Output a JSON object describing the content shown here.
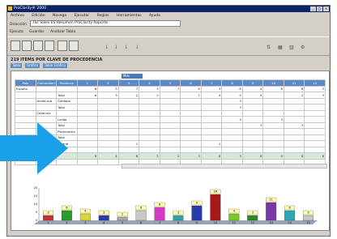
{
  "window": {
    "title": "ProClarity® 2000"
  },
  "menu": [
    "Archivo",
    "Edición",
    "Navega",
    "Ejecutar",
    "Reglas",
    "Herramientas",
    "Ayuda"
  ],
  "address": {
    "label": "Dirección",
    "url": "Fac Sales ES Resumen ProClarity Reporte"
  },
  "toolbar1": [
    "Ejecuta",
    "Guardar",
    "Analizar Tabla"
  ],
  "query": {
    "title": "219 ITEMS POR CLAVE DE PROCEDENCIA",
    "chips": [
      "Tabla",
      "Gráfico",
      "Tabla Gráfico"
    ]
  },
  "grid": {
    "colgroup_label": "Mes",
    "row_headers": [
      "País",
      "Comunidad",
      "Provincia"
    ],
    "col_labels": [
      "1",
      "2",
      "3",
      "4",
      "5",
      "6",
      "7",
      "8",
      "9",
      "10",
      "11",
      "12"
    ],
    "rows": [
      {
        "a": "España",
        "b": "",
        "c": "",
        "cells": [
          "8",
          "3",
          "7",
          "3",
          "7",
          "9",
          "3",
          "8",
          "4",
          "6",
          "8",
          "3"
        ]
      },
      {
        "a": "",
        "b": "",
        "c": "Total",
        "cells": [
          "8",
          "3",
          "2",
          "3",
          "",
          "7",
          "4",
          "5",
          "5",
          "",
          "2",
          "3"
        ]
      },
      {
        "a": "",
        "b": "Andalucía",
        "c": "Córdoba",
        "cells": [
          "",
          "",
          "",
          "",
          "",
          "",
          "",
          "3",
          "",
          "",
          "",
          ""
        ]
      },
      {
        "a": "",
        "b": "",
        "c": "Total",
        "cells": [
          "",
          "",
          "",
          "",
          "",
          "",
          "",
          "3",
          "",
          "",
          "",
          ""
        ]
      },
      {
        "a": "",
        "b": "Cataluña",
        "c": "",
        "cells": [
          "",
          "",
          "",
          "",
          "",
          "",
          "",
          "",
          "",
          "",
          "",
          ""
        ]
      },
      {
        "a": "",
        "b": "",
        "c": "Lleida",
        "cells": [
          "",
          "",
          "",
          "",
          "",
          "",
          "",
          "4",
          "",
          "3",
          "",
          ""
        ]
      },
      {
        "a": "",
        "b": "",
        "c": "Total",
        "cells": [
          "",
          "",
          "",
          "",
          "",
          "",
          "",
          "",
          "3",
          "",
          "3",
          ""
        ]
      },
      {
        "a": "",
        "b": "Galicia",
        "c": "Pontevedra",
        "cells": [
          "",
          "",
          "",
          "",
          "",
          "",
          "",
          "",
          "",
          "",
          "",
          ""
        ]
      },
      {
        "a": "",
        "b": "",
        "c": "Total",
        "cells": [
          "",
          "",
          "",
          "",
          "",
          "",
          "",
          "",
          "",
          "",
          "",
          ""
        ]
      },
      {
        "a": "",
        "b": "Madrid",
        "c": "Madrid",
        "cells": [
          "",
          "",
          "1",
          "",
          "",
          "",
          "1",
          "",
          "",
          "",
          "",
          ""
        ]
      },
      {
        "a": "",
        "b": "",
        "c": "Total",
        "cells": [
          "",
          "",
          "",
          "",
          "",
          "",
          "",
          "",
          "",
          "",
          "",
          ""
        ]
      },
      {
        "a": "",
        "b": "",
        "c": "",
        "cells": [
          "9",
          "4",
          "8",
          "2",
          "2",
          "3",
          "8",
          "3",
          "8",
          "9",
          "8",
          "6"
        ]
      },
      {
        "a": "",
        "b": "",
        "c": "",
        "cells": [
          "",
          "",
          "",
          "",
          "",
          "",
          "",
          "",
          "",
          "",
          "",
          ""
        ]
      }
    ]
  },
  "chart_data": {
    "type": "bar",
    "title": "",
    "xlabel": "",
    "ylabel": "",
    "categories": [
      "1",
      "2",
      "3",
      "4",
      "5",
      "6",
      "7",
      "8",
      "9",
      "10",
      "11",
      "12",
      "13",
      "14",
      "15"
    ],
    "values": [
      3,
      6,
      4,
      3,
      2,
      6,
      8,
      3,
      9,
      16,
      4,
      3,
      11,
      6,
      3
    ],
    "colors": [
      "#c83030",
      "#2a9a2a",
      "#d8d838",
      "#2a3aa8",
      "#a8a8a8",
      "#c8c8c8",
      "#d838c8",
      "#2aa8a8",
      "#2a3aa8",
      "#a81818",
      "#78c828",
      "#2a8a2a",
      "#7838a8",
      "#2aa8b8",
      "#c8c8c8"
    ],
    "ylim": [
      0,
      20
    ],
    "grid": false
  },
  "colors": {
    "overlay_arrow": "#1aa0e8",
    "header_blue": "#5b8ac4",
    "title_blue": "#0a246a"
  },
  "icons": {
    "overlay": "right-arrow-icon"
  }
}
